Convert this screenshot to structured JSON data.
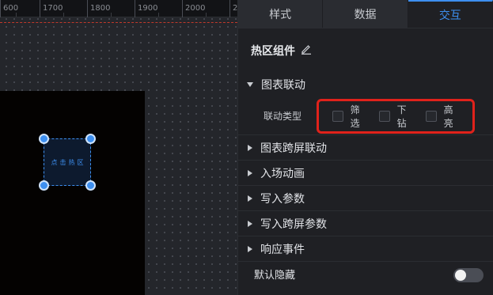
{
  "ruler": {
    "ticks": [
      "600",
      "1700",
      "1800",
      "1900",
      "2000",
      "2"
    ]
  },
  "canvas": {
    "hotspot_label": "点击热区"
  },
  "tabs": [
    {
      "label": "样式",
      "active": false
    },
    {
      "label": "数据",
      "active": false
    },
    {
      "label": "交互",
      "active": true
    }
  ],
  "component": {
    "title": "热区组件",
    "edit_icon": "pencil-icon"
  },
  "chart_link": {
    "title": "图表联动",
    "expanded": true,
    "type_label": "联动类型",
    "options": [
      {
        "label": "筛选",
        "checked": false
      },
      {
        "label": "下钻",
        "checked": false
      },
      {
        "label": "高亮",
        "checked": false
      }
    ]
  },
  "sections": [
    {
      "title": "图表跨屏联动"
    },
    {
      "title": "入场动画"
    },
    {
      "title": "写入参数"
    },
    {
      "title": "写入跨屏参数"
    },
    {
      "title": "响应事件"
    }
  ],
  "default_hidden": {
    "label": "默认隐藏",
    "enabled": false
  },
  "colors": {
    "accent": "#3d8ff0",
    "highlight_box": "#e0221b"
  }
}
